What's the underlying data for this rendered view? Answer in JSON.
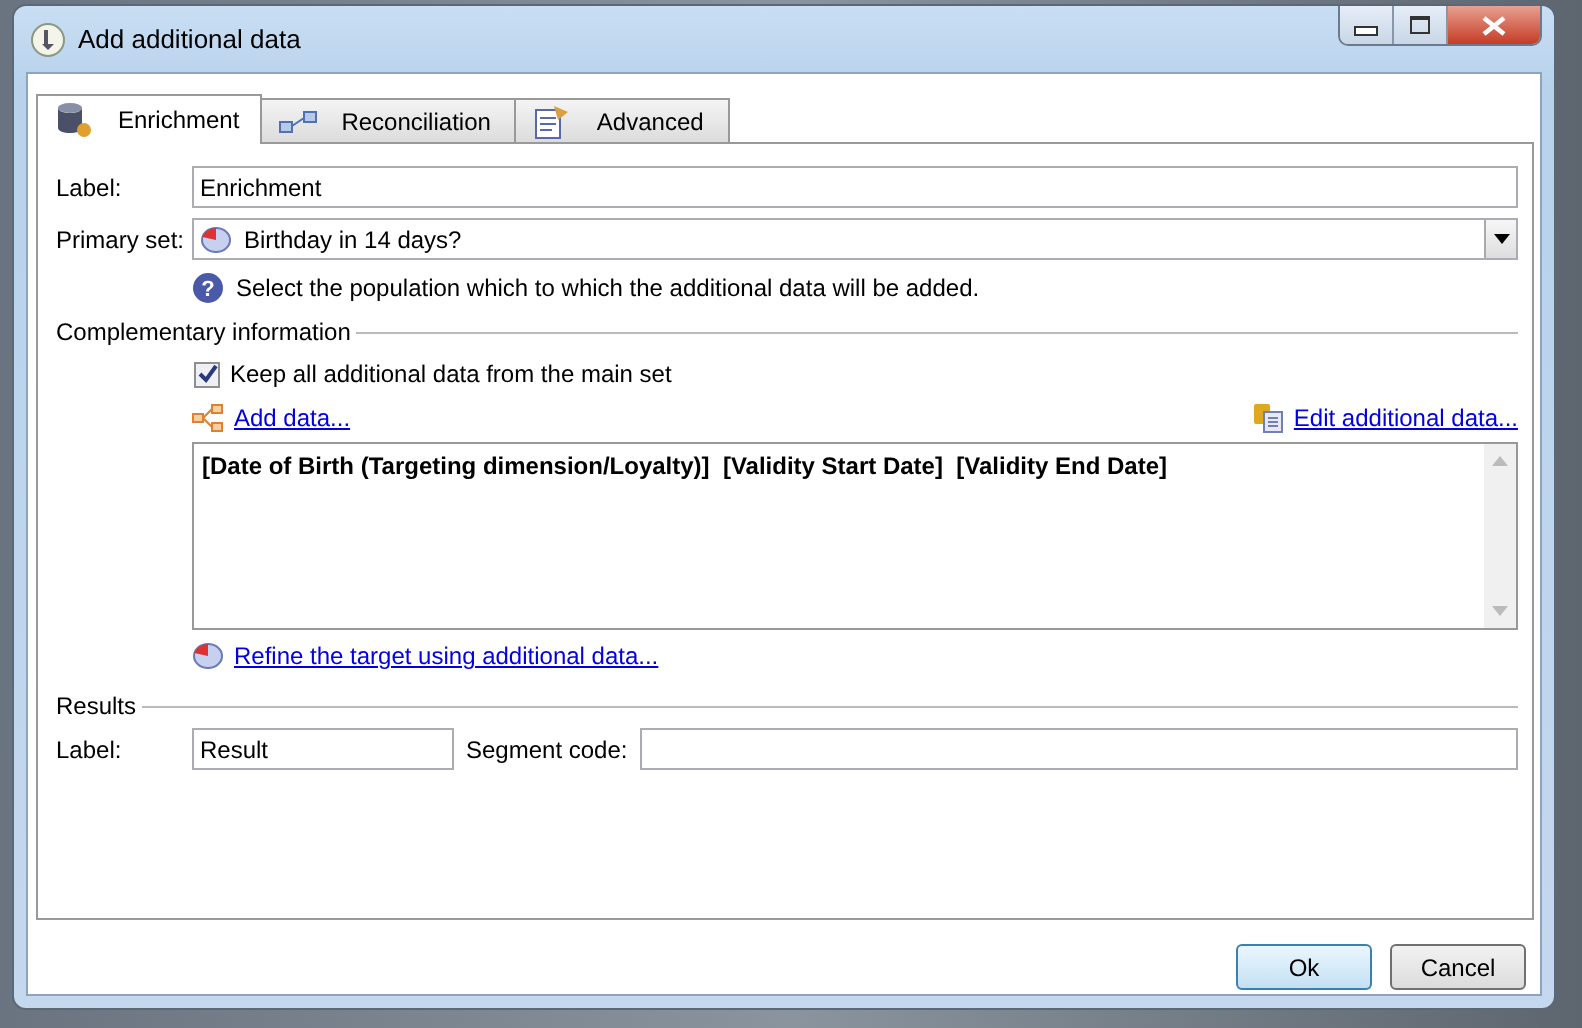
{
  "window": {
    "title": "Add additional data"
  },
  "tabs": [
    {
      "label": "Enrichment",
      "selected": true,
      "kind": "database"
    },
    {
      "label": "Reconciliation",
      "selected": false,
      "kind": "link"
    },
    {
      "label": "Advanced",
      "selected": false,
      "kind": "document"
    }
  ],
  "label_field": {
    "label": "Label:",
    "value": "Enrichment"
  },
  "primary_set": {
    "label": "Primary set:",
    "value": "Birthday in 14 days?",
    "help_icon": "?",
    "help": "Select the population which to which the additional data will be added."
  },
  "complementary": {
    "title": "Complementary information",
    "keep_all": {
      "label": "Keep all additional data from the main set",
      "checked": true
    },
    "add_link": "Add data...",
    "edit_link": "Edit additional data...",
    "data_text": "[Date of Birth (Targeting dimension/Loyalty)]  [Validity Start Date]  [Validity End Date]",
    "refine_link": "Refine the target using additional data..."
  },
  "results": {
    "title": "Results",
    "label": "Label:",
    "value": "Result",
    "segment_label": "Segment code:"
  },
  "buttons": [
    {
      "label": "Ok",
      "default": true
    },
    {
      "label": "Cancel",
      "default": false
    }
  ]
}
